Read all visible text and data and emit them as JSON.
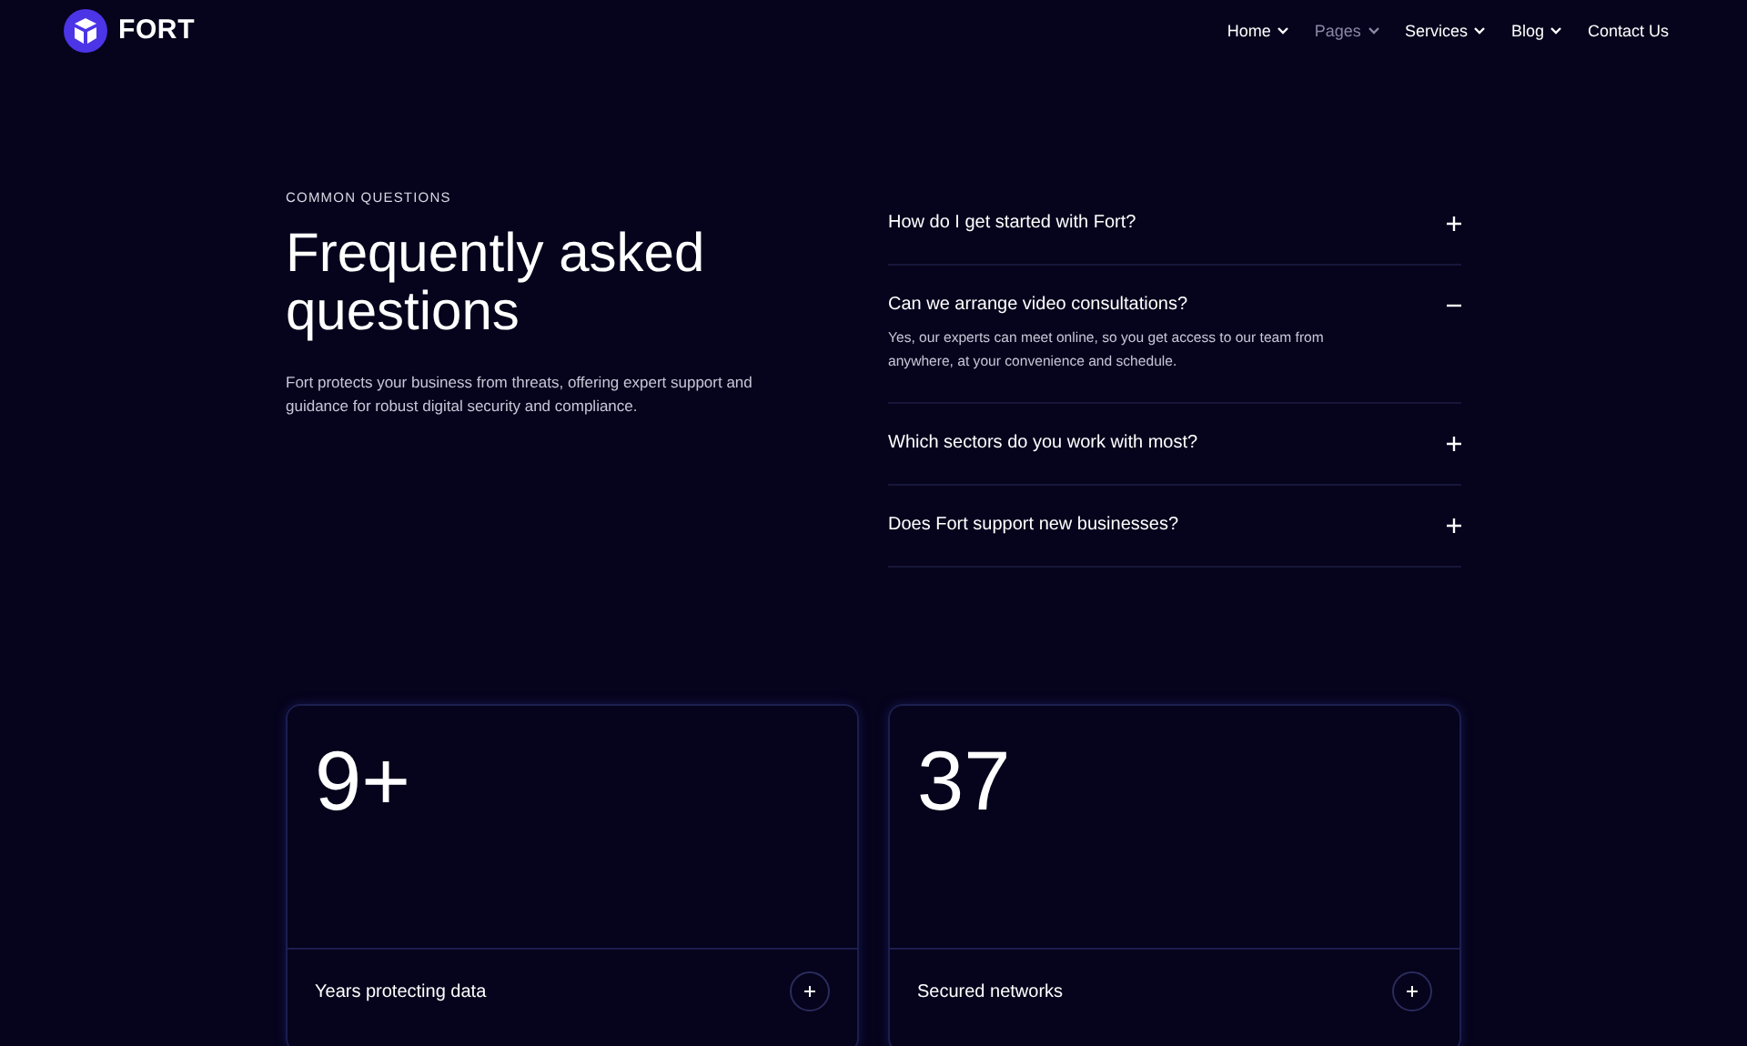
{
  "header": {
    "brand": "FORT",
    "nav": [
      {
        "label": "Home",
        "selected": false,
        "dropdown": true
      },
      {
        "label": "Pages",
        "selected": true,
        "dropdown": true
      },
      {
        "label": "Services",
        "selected": false,
        "dropdown": true
      },
      {
        "label": "Blog",
        "selected": false,
        "dropdown": true
      },
      {
        "label": "Contact Us",
        "selected": false,
        "dropdown": false
      }
    ]
  },
  "faq": {
    "eyebrow": "COMMON QUESTIONS",
    "title": "Frequently asked questions",
    "intro": "Fort protects your business from threats, offering expert support and guidance for robust digital security and compliance.",
    "items": [
      {
        "question": "How do I get started with Fort?",
        "expanded": false
      },
      {
        "question": "Can we arrange video consultations?",
        "expanded": true,
        "answer": "Yes, our experts can meet online, so you get access to our team from anywhere, at your convenience and schedule."
      },
      {
        "question": "Which sectors do you work with most?",
        "expanded": false
      },
      {
        "question": "Does Fort support new businesses?",
        "expanded": false
      }
    ]
  },
  "stats": [
    {
      "value": "9+",
      "label": "Years protecting data"
    },
    {
      "value": "37",
      "label": "Secured networks"
    }
  ]
}
